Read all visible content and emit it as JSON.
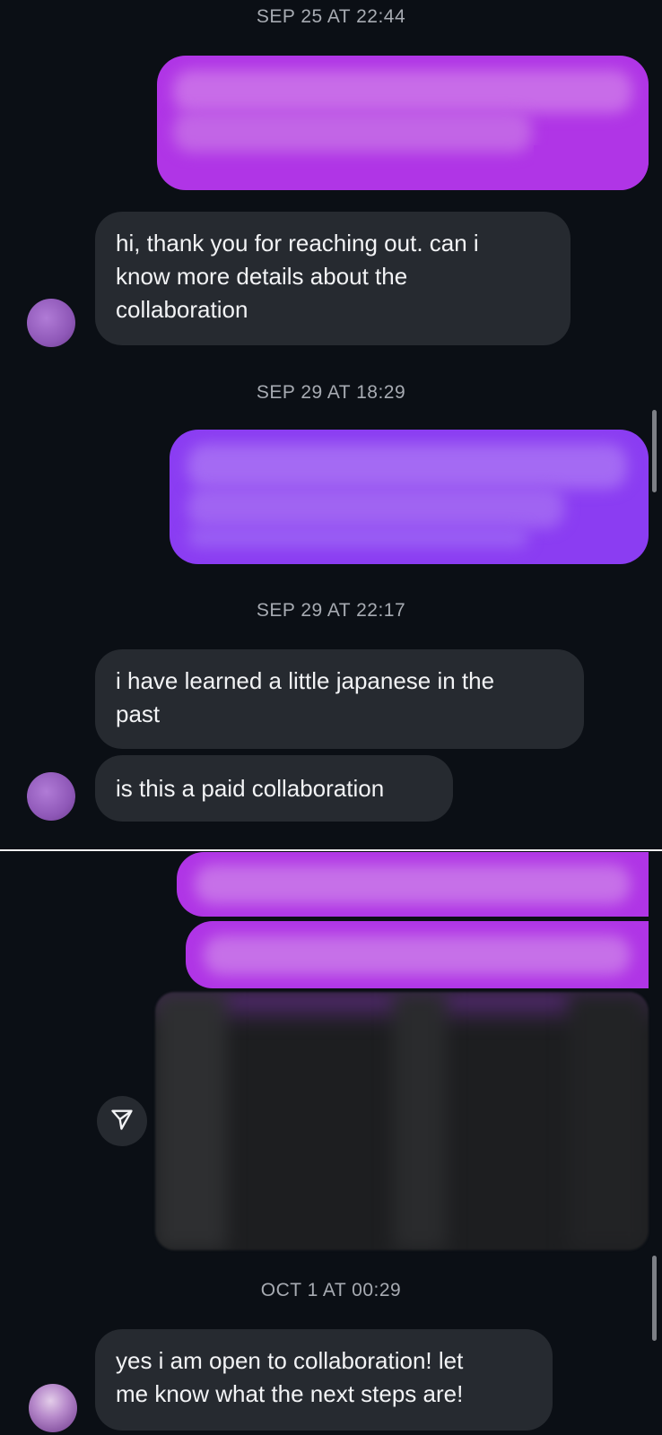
{
  "timestamps": [
    "SEP 25 AT 22:44",
    "SEP 29 AT 18:29",
    "SEP 29 AT 22:17",
    "OCT 1 AT 00:29"
  ],
  "messages": {
    "m1_lines": [
      "hi, thank you for reaching out. can i",
      "know more details about the",
      "collaboration"
    ],
    "m2_lines": [
      "i have learned a little japanese in the",
      "past"
    ],
    "m3": "is this a paid collaboration",
    "m4_lines": [
      "yes i am open to collaboration! let",
      "me know what the next steps are!"
    ]
  },
  "colors": {
    "outgoing_magenta": "#b035e6",
    "outgoing_violet": "#8b3df2",
    "incoming_bg": "#262a30",
    "background": "#0b0f15"
  },
  "icons": {
    "share": "paper-plane-icon"
  }
}
